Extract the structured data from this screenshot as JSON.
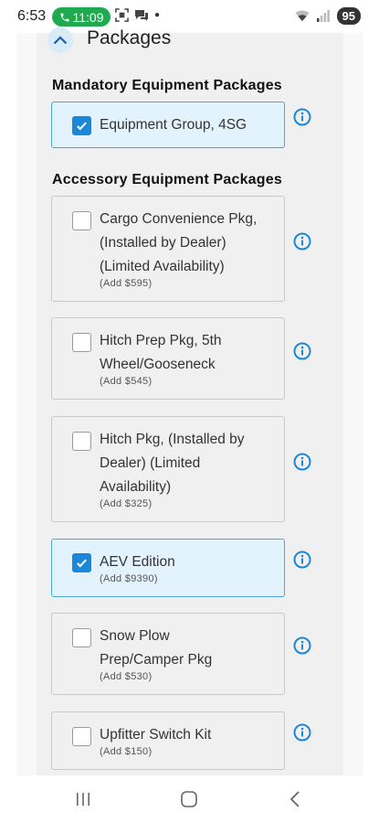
{
  "status_bar": {
    "time": "6:53",
    "call_time": "11:09",
    "battery": "95"
  },
  "section": {
    "title": "Packages"
  },
  "mandatory": {
    "title": "Mandatory Equipment Packages",
    "items": [
      {
        "name": "Equipment Group, 4SG",
        "checked": true
      }
    ]
  },
  "accessory": {
    "title": "Accessory Equipment Packages",
    "items": [
      {
        "name_lines": [
          "Cargo Convenience Pkg,",
          "(Installed by Dealer)",
          "(Limited Availability)"
        ],
        "price": "(Add $595)",
        "checked": false
      },
      {
        "name_lines": [
          "Hitch Prep Pkg, 5th",
          "Wheel/Gooseneck"
        ],
        "price": "(Add $545)",
        "checked": false
      },
      {
        "name_lines": [
          "Hitch Pkg, (Installed by",
          "Dealer) (Limited",
          "Availability)"
        ],
        "price": "(Add $325)",
        "checked": false
      },
      {
        "name_lines": [
          "AEV Edition"
        ],
        "price": "(Add $9390)",
        "checked": true
      },
      {
        "name_lines": [
          "Snow Plow",
          "Prep/Camper Pkg"
        ],
        "price": "(Add $530)",
        "checked": false
      },
      {
        "name_lines": [
          "Upfitter Switch Kit"
        ],
        "price": "(Add $150)",
        "checked": false
      }
    ]
  },
  "colors": {
    "accent": "#1b87d8",
    "selected_bg": "#e3f3fd",
    "call_green": "#1faa4f"
  }
}
